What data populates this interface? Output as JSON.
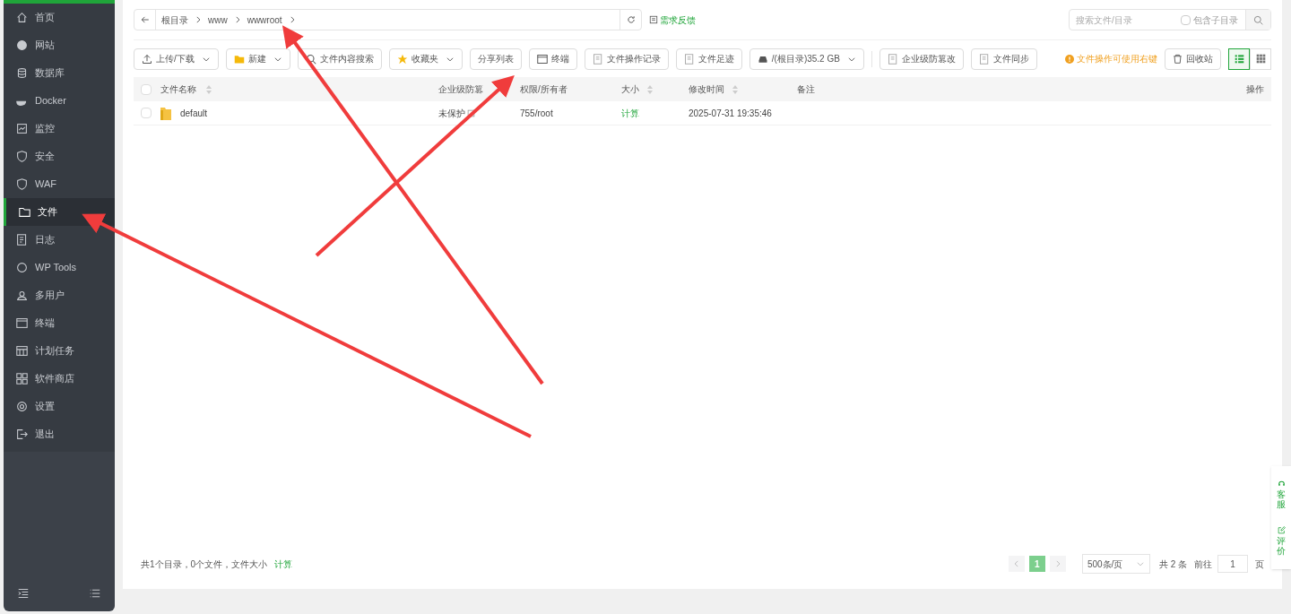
{
  "sidebar": {
    "items": [
      {
        "label": "首页",
        "kind": "home",
        "selected": false
      },
      {
        "label": "网站",
        "kind": "globe",
        "selected": false
      },
      {
        "label": "数据库",
        "kind": "db",
        "selected": false
      },
      {
        "label": "Docker",
        "kind": "docker",
        "selected": false
      },
      {
        "label": "监控",
        "kind": "monitor",
        "selected": false
      },
      {
        "label": "安全",
        "kind": "shield",
        "selected": false
      },
      {
        "label": "WAF",
        "kind": "shield",
        "selected": false
      },
      {
        "label": "文件",
        "kind": "folder",
        "selected": true
      },
      {
        "label": "日志",
        "kind": "log",
        "selected": false
      },
      {
        "label": "WP Tools",
        "kind": "wp",
        "selected": false
      },
      {
        "label": "多用户",
        "kind": "users",
        "selected": false
      },
      {
        "label": "终端",
        "kind": "terminal",
        "selected": false
      },
      {
        "label": "计划任务",
        "kind": "calendar",
        "selected": false
      },
      {
        "label": "软件商店",
        "kind": "grid",
        "selected": false
      },
      {
        "label": "设置",
        "kind": "gear",
        "selected": false
      },
      {
        "label": "退出",
        "kind": "exit",
        "selected": false
      }
    ]
  },
  "breadcrumb": [
    "根目录",
    "www",
    "wwwroot"
  ],
  "feedback": "需求反馈",
  "search": {
    "placeholder": "搜索文件/目录",
    "subdir_label": "包含子目录",
    "subdir_checked": false
  },
  "toolbar": [
    {
      "label": "上传/下载",
      "kind": "upload",
      "dropdown": true
    },
    {
      "label": "新建",
      "kind": "folder",
      "dropdown": true
    },
    {
      "label": "文件内容搜索",
      "kind": "search",
      "dropdown": false
    },
    {
      "label": "收藏夹",
      "kind": "star",
      "dropdown": true
    },
    {
      "label": "分享列表",
      "kind": "plain",
      "dropdown": false
    },
    {
      "label": "终端",
      "kind": "terminal",
      "dropdown": false
    },
    {
      "label": "文件操作记录",
      "kind": "doc",
      "dropdown": false
    },
    {
      "label": "文件足迹",
      "kind": "doc",
      "dropdown": false
    },
    {
      "label": "/(根目录)35.2 GB",
      "kind": "disk",
      "dropdown": true
    },
    {
      "label": "企业级防篡改",
      "kind": "doc",
      "dropdown": false
    },
    {
      "label": "文件同步",
      "kind": "doc",
      "dropdown": false
    }
  ],
  "tip": "文件操作可使用右键",
  "recycle": "回收站",
  "view_modes": [
    {
      "kind": "list",
      "selected": true
    },
    {
      "kind": "grid",
      "selected": false
    }
  ],
  "table": {
    "select_all_checked": false,
    "columns": [
      "文件名称",
      "企业级防篡",
      "权限/所有者",
      "大小",
      "修改时间",
      "备注",
      "操作"
    ],
    "rows": [
      {
        "name": "default",
        "protect": "未保护",
        "perm": "755/root",
        "size": "计算",
        "mtime": "2025-07-31 19:35:46",
        "checked": false
      }
    ]
  },
  "summary": {
    "text": "共1个目录，0个文件，文件大小",
    "link": "计算"
  },
  "pagination": {
    "pages": [
      {
        "label": "1",
        "selected": true
      }
    ],
    "page_size": "500条/页",
    "total": "共 2 条",
    "goto": "前往",
    "goto_value": "1",
    "page_unit": "页"
  },
  "side_widget": [
    {
      "label": "客服",
      "kind": "headset"
    },
    {
      "label": "评价",
      "kind": "edit"
    }
  ]
}
